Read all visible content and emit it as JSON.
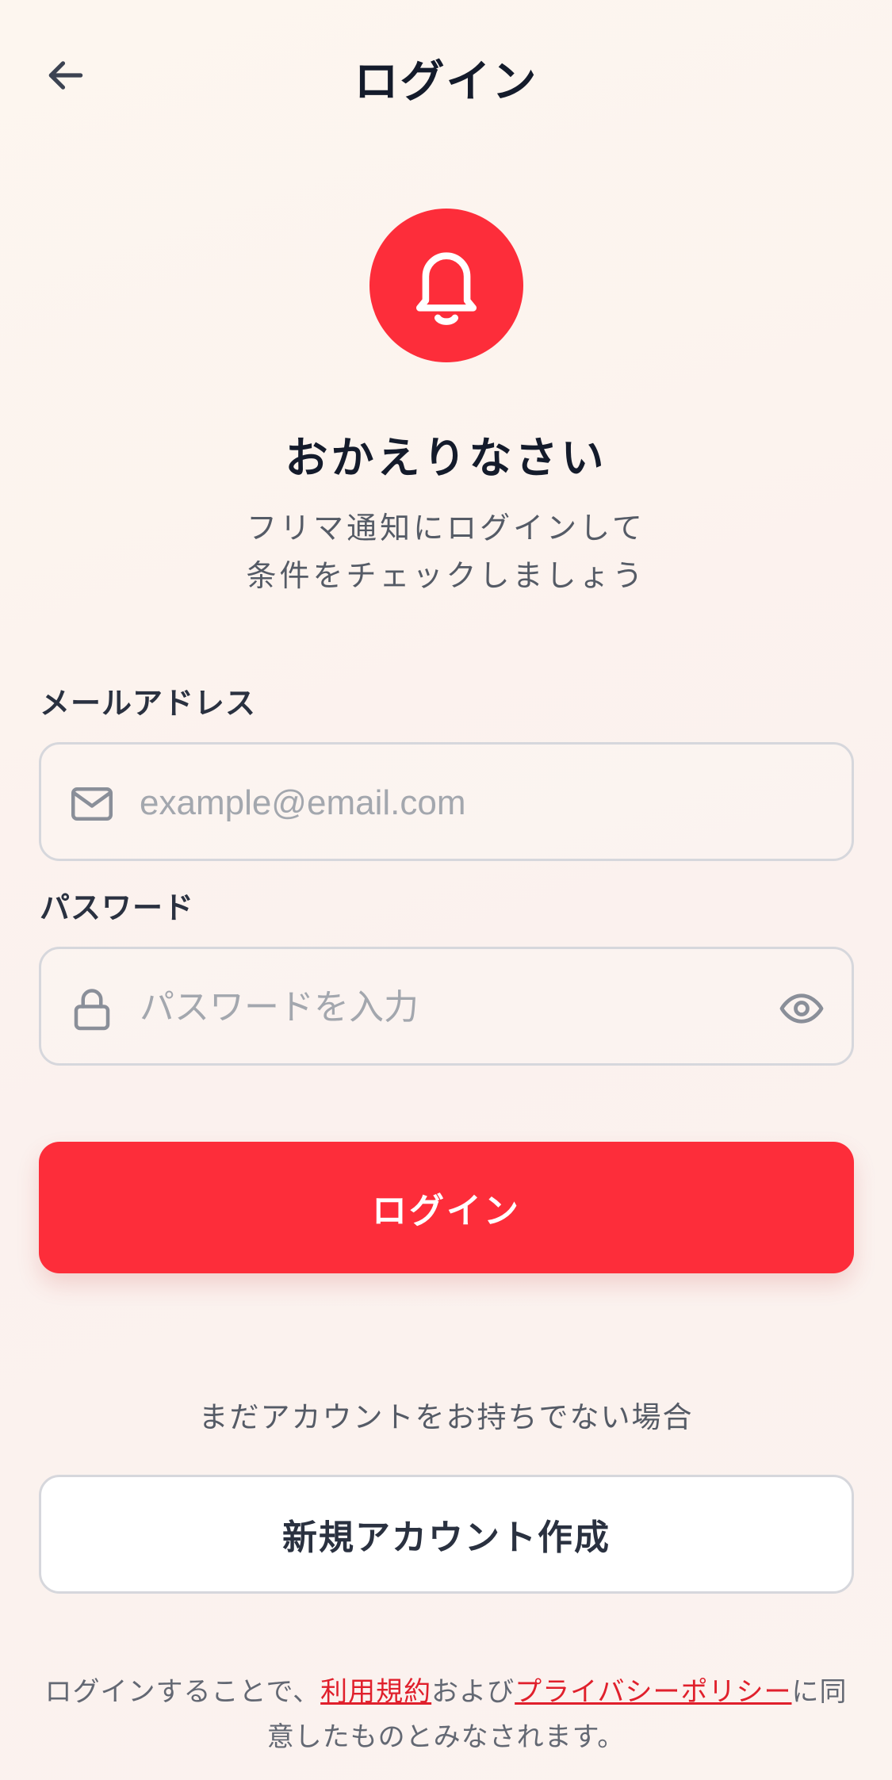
{
  "header": {
    "title": "ログイン",
    "back_icon": "arrow-left-icon"
  },
  "hero": {
    "icon": "bell-icon",
    "accent_color": "#fd2d3a",
    "heading": "おかえりなさい",
    "subtitle_line1": "フリマ通知にログインして",
    "subtitle_line2": "条件をチェックしましょう"
  },
  "form": {
    "email": {
      "label": "メールアドレス",
      "placeholder": "example@email.com",
      "value": "",
      "icon": "mail-icon"
    },
    "password": {
      "label": "パスワード",
      "placeholder": "パスワードを入力",
      "value": "",
      "icon": "lock-icon",
      "toggle_icon": "eye-icon"
    },
    "submit_label": "ログイン"
  },
  "signup": {
    "prompt": "まだアカウントをお持ちでない場合",
    "button_label": "新規アカウント作成"
  },
  "legal": {
    "prefix": "ログインすることで、",
    "terms_link": "利用規約",
    "middle": "および",
    "privacy_link": "プライバシーポリシー",
    "suffix": "に同意したものとみなされます。"
  }
}
